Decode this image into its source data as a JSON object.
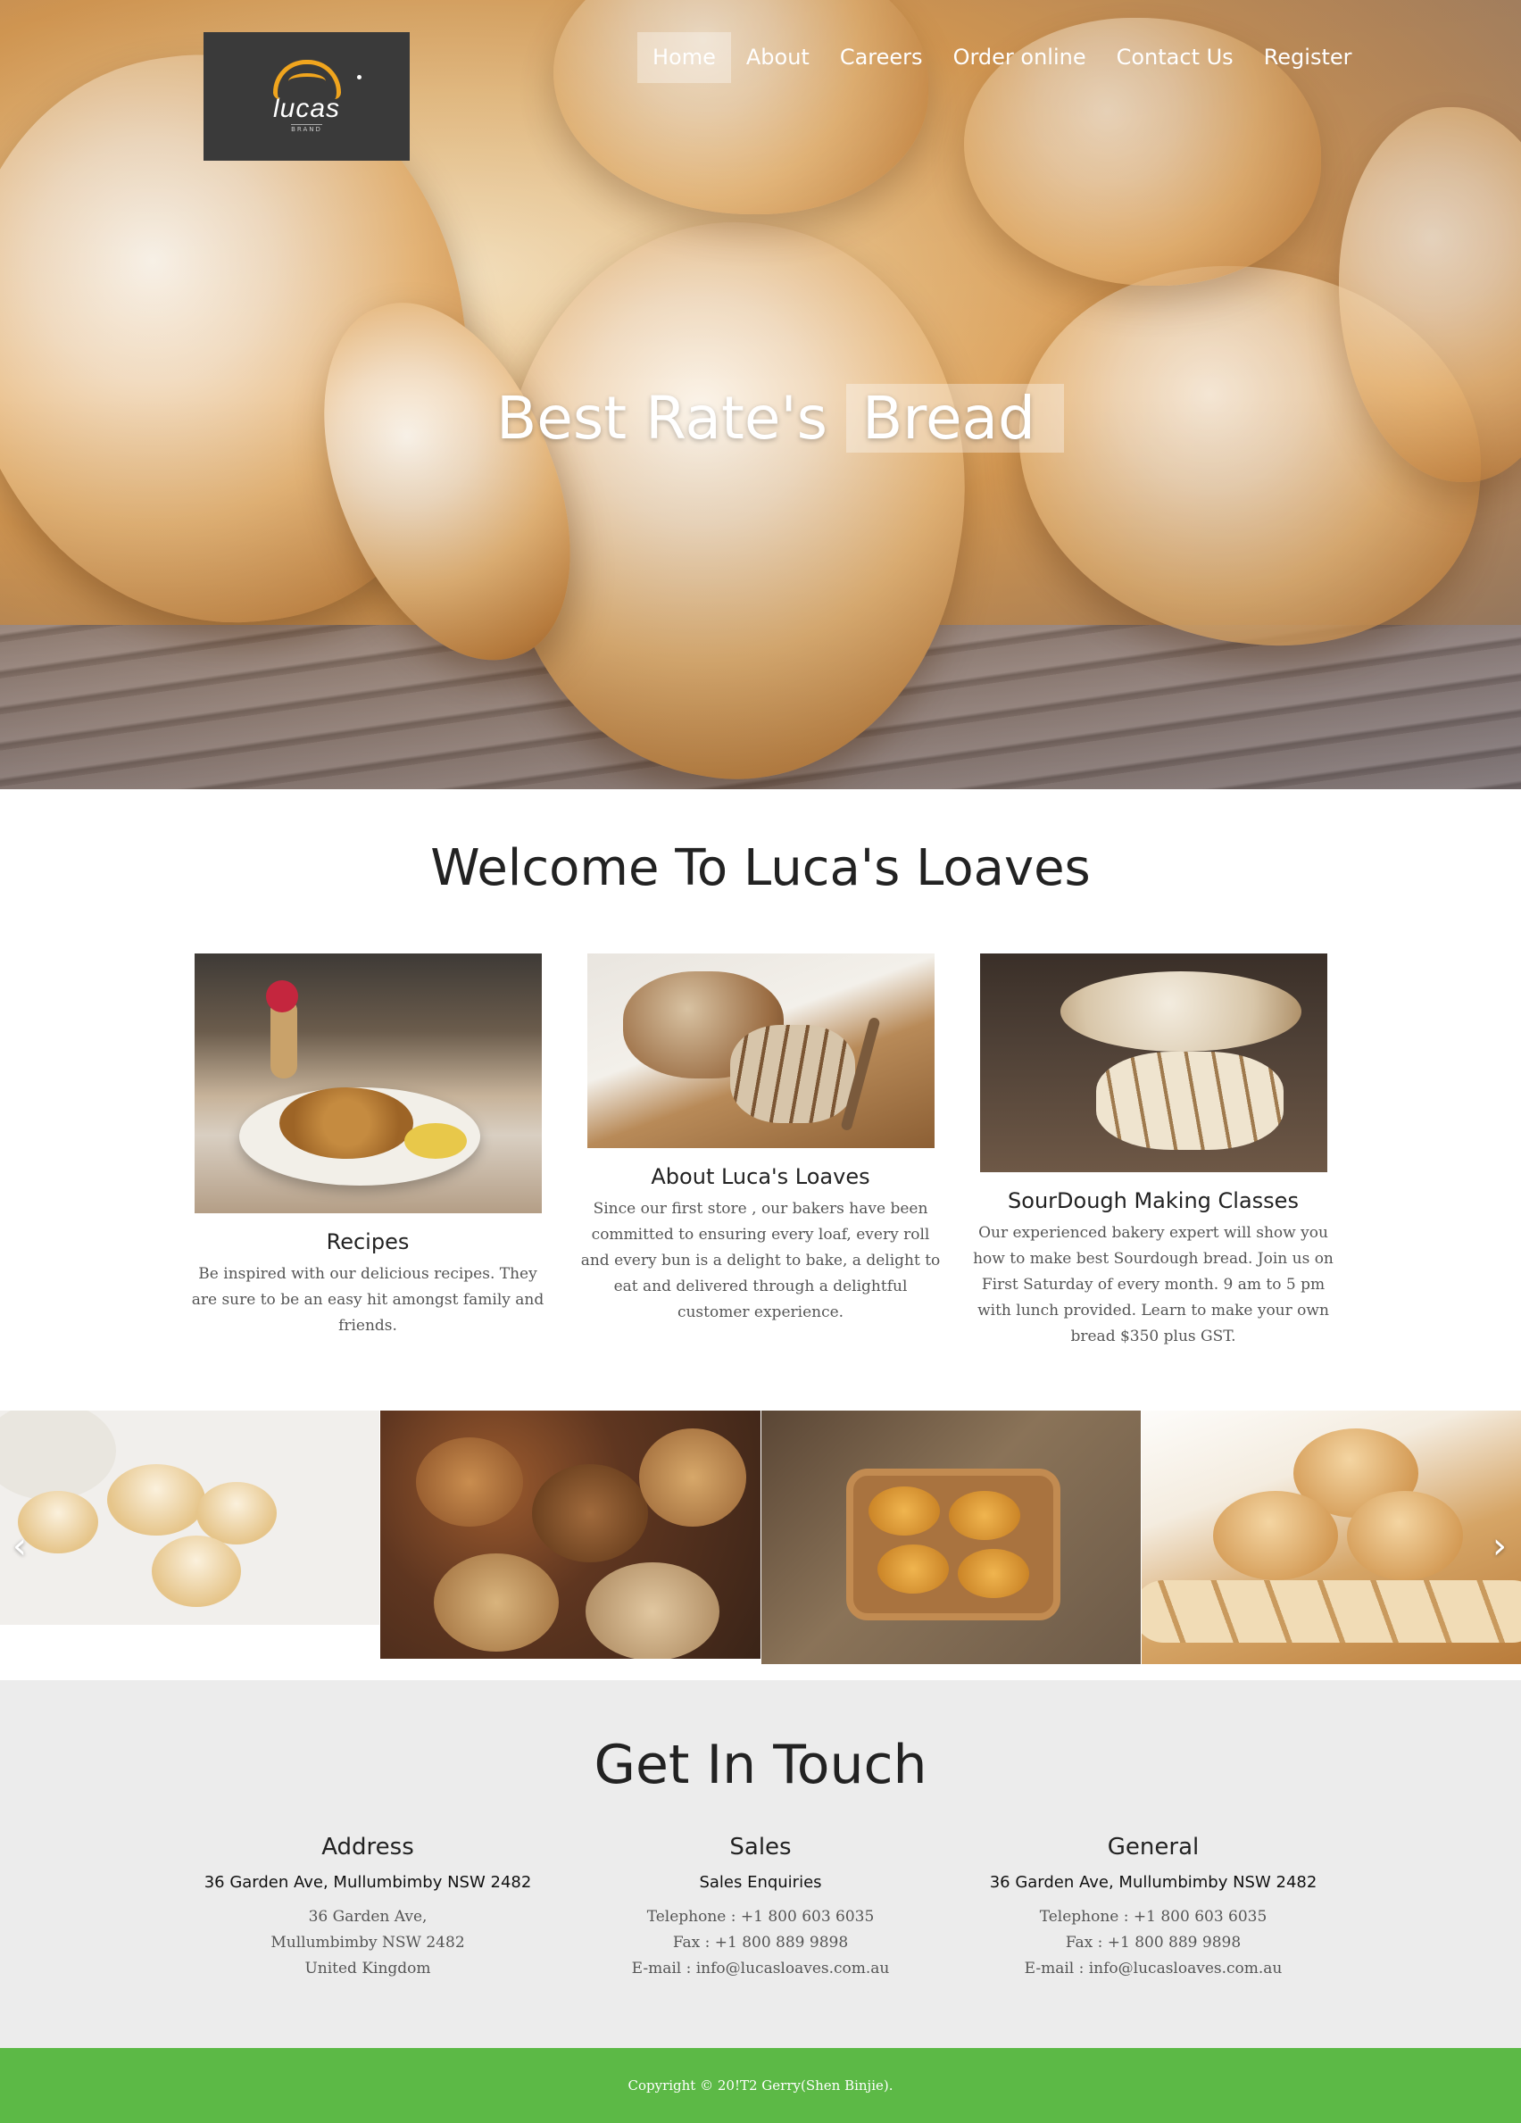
{
  "nav": {
    "logo_text": "lucas",
    "logo_sub": "BRAND",
    "items": [
      {
        "label": "Home"
      },
      {
        "label": "About"
      },
      {
        "label": "Careers"
      },
      {
        "label": "Order online"
      },
      {
        "label": "Contact Us"
      },
      {
        "label": "Register"
      }
    ]
  },
  "hero": {
    "title_part1": "Best Rate's ",
    "title_part2": "Bread"
  },
  "welcome": {
    "title": "Welcome To Luca's Loaves",
    "cards": [
      {
        "title": "Recipes",
        "text": "Be inspired with our delicious recipes. They are sure to be an easy hit amongst family and friends."
      },
      {
        "title": "About Luca's Loaves",
        "text": "Since our first store , our bakers have been committed to ensuring every loaf, every roll and every bun is a delight to bake, a delight to eat and delivered through a delightful customer experience."
      },
      {
        "title": "SourDough Making Classes",
        "text": "Our experienced bakery expert will show you how to make best Sourdough bread. Join us on First Saturday of every month. 9 am to 5 pm with lunch provided. Learn to make your own bread $350 plus GST."
      }
    ]
  },
  "gallery": {
    "prev": "‹",
    "next": "›"
  },
  "contact": {
    "title": "Get In Touch",
    "columns": [
      {
        "heading": "Address",
        "strong": "36 Garden Ave, Mullumbimby NSW 2482",
        "lines": [
          "36 Garden Ave,",
          "Mullumbimby NSW 2482",
          "United Kingdom"
        ]
      },
      {
        "heading": "Sales",
        "strong": "Sales Enquiries",
        "lines": [
          "Telephone : +1 800 603 6035",
          "Fax : +1 800 889 9898",
          "E-mail : info@lucasloaves.com.au"
        ]
      },
      {
        "heading": "General",
        "strong": "36 Garden Ave, Mullumbimby NSW 2482",
        "lines": [
          "Telephone : +1 800 603 6035",
          "Fax : +1 800 889 9898",
          "E-mail : info@lucasloaves.com.au"
        ]
      }
    ]
  },
  "footer": {
    "copyright": "Copyright © 20!T2 Gerry(Shen Binjie)."
  }
}
